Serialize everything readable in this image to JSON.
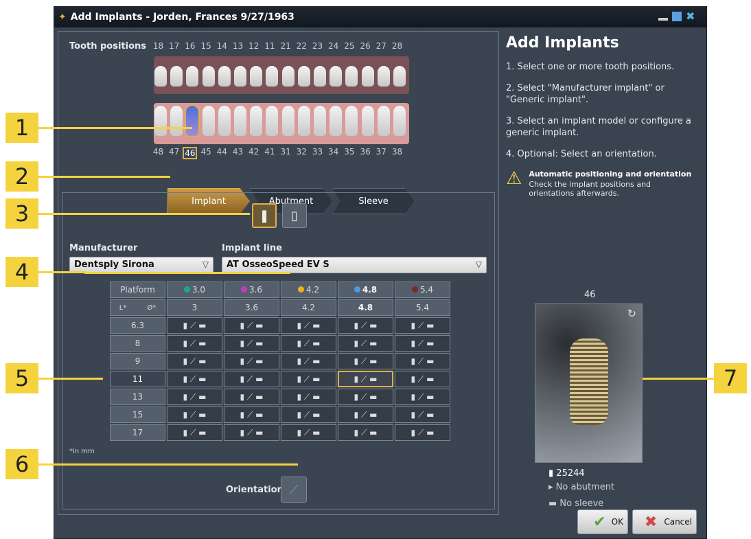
{
  "window": {
    "title": "Add Implants - Jorden, Frances 9/27/1963",
    "controls": [
      "minimize-icon",
      "restore-icon",
      "close-icon"
    ]
  },
  "teeth": {
    "label": "Tooth positions",
    "upper_numbers": [
      "18",
      "17",
      "16",
      "15",
      "14",
      "13",
      "12",
      "11",
      "21",
      "22",
      "23",
      "24",
      "25",
      "26",
      "27",
      "28"
    ],
    "lower_numbers": [
      "48",
      "47",
      "46",
      "45",
      "44",
      "43",
      "42",
      "41",
      "31",
      "32",
      "33",
      "34",
      "35",
      "36",
      "37",
      "38"
    ],
    "selected": "46"
  },
  "tabs": [
    "Implant",
    "Abutment",
    "Sleeve"
  ],
  "manufacturer": {
    "label": "Manufacturer",
    "value": "Dentsply Sirona"
  },
  "implant_line": {
    "label": "Implant line",
    "value": "AT OsseoSpeed EV S"
  },
  "table": {
    "platform_label": "Platform",
    "length_symbol": "L*",
    "diameter_symbol": "Ø*",
    "platforms": [
      {
        "label": "3.0",
        "color": "#1aa98a"
      },
      {
        "label": "3.6",
        "color": "#c03cc4"
      },
      {
        "label": "4.2",
        "color": "#f0b21d"
      },
      {
        "label": "4.8",
        "color": "#4a9be4"
      },
      {
        "label": "5.4",
        "color": "#7a2a2a"
      }
    ],
    "diameters": [
      "3",
      "3.6",
      "4.2",
      "4.8",
      "5.4"
    ],
    "lengths": [
      "6.3",
      "8",
      "9",
      "11",
      "13",
      "15",
      "17"
    ],
    "selected_length": "11",
    "selected_platform": "4.8",
    "footnote": "*in mm"
  },
  "orientation_label": "Orientation",
  "right": {
    "title": "Add Implants",
    "steps": [
      "1. Select one or more tooth positions.",
      "2. Select \"Manufacturer implant\" or \"Generic implant\".",
      "3. Select an implant model or configure a generic implant.",
      "4. Optional: Select an orientation."
    ],
    "warning_title": "Automatic positioning and orientation",
    "warning_text": "Check the implant positions and orientations afterwards.",
    "preview_tooth": "46",
    "implant_number": "25244",
    "abutment": "No abutment",
    "sleeve": "No sleeve"
  },
  "buttons": {
    "ok": "OK",
    "cancel": "Cancel"
  },
  "callouts": [
    "1",
    "2",
    "3",
    "4",
    "5",
    "6",
    "7"
  ],
  "colors": {
    "accent": "#e2ad4a",
    "callout": "#f4d33f"
  }
}
